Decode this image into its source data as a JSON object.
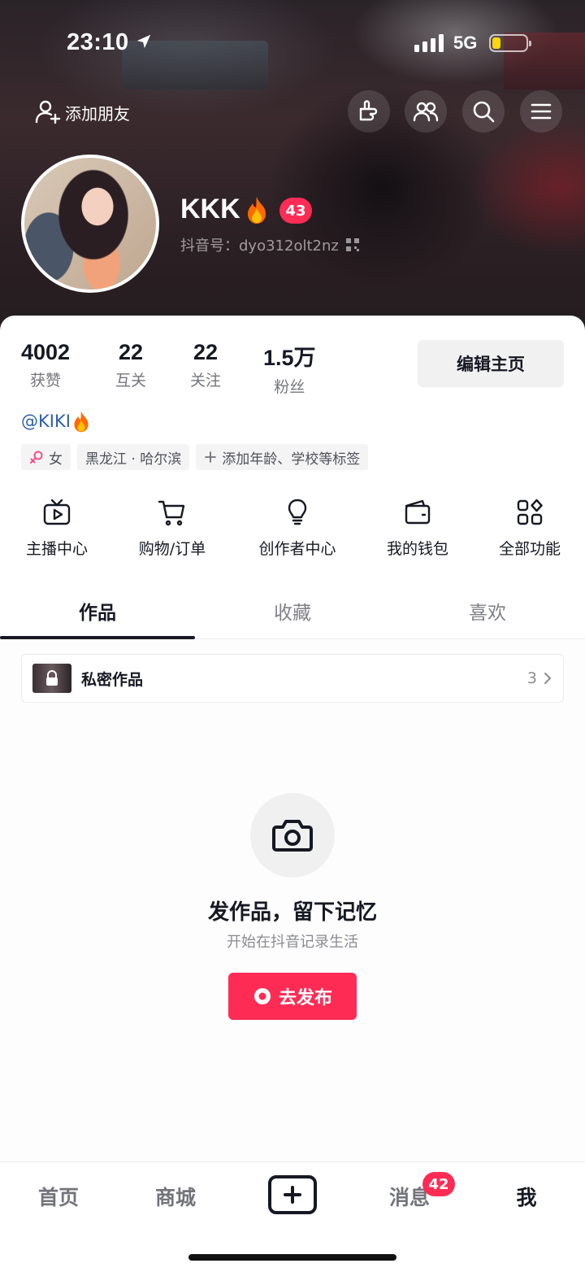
{
  "status_bar": {
    "time": "23:10",
    "network": "5G",
    "battery_level": 0.25
  },
  "header": {
    "add_friend_label": "添加朋友",
    "actions": [
      "hand-icon",
      "friends-icon",
      "search-icon",
      "menu-icon"
    ]
  },
  "profile": {
    "nickname": "KKK",
    "level": "43",
    "douyin_id": "抖音号：dyo312olt2nz",
    "handle": "@KIKI"
  },
  "stats": [
    {
      "value": "4002",
      "label": "获赞"
    },
    {
      "value": "22",
      "label": "互关"
    },
    {
      "value": "22",
      "label": "关注"
    },
    {
      "value": "1.5万",
      "label": "粉丝"
    }
  ],
  "edit_button": "编辑主页",
  "tags": {
    "gender": "女",
    "location": "黑龙江 · 哈尔滨",
    "add": "添加年龄、学校等标签"
  },
  "functions": [
    {
      "label": "主播中心",
      "icon": "tv-icon"
    },
    {
      "label": "购物/订单",
      "icon": "cart-icon"
    },
    {
      "label": "创作者中心",
      "icon": "bulb-icon"
    },
    {
      "label": "我的钱包",
      "icon": "wallet-icon"
    },
    {
      "label": "全部功能",
      "icon": "grid-icon"
    }
  ],
  "tabs": [
    {
      "label": "作品",
      "active": true
    },
    {
      "label": "收藏",
      "active": false
    },
    {
      "label": "喜欢",
      "active": false
    }
  ],
  "private_works": {
    "label": "私密作品",
    "count": "3"
  },
  "empty_state": {
    "title": "发作品，留下记忆",
    "subtitle": "开始在抖音记录生活",
    "button": "去发布"
  },
  "bottom_nav": {
    "home": "首页",
    "mall": "商城",
    "messages": "消息",
    "messages_badge": "42",
    "me": "我"
  },
  "colors": {
    "accent": "#fe2c55",
    "handle": "#2c5fa8",
    "battery": "#ffd60a"
  }
}
